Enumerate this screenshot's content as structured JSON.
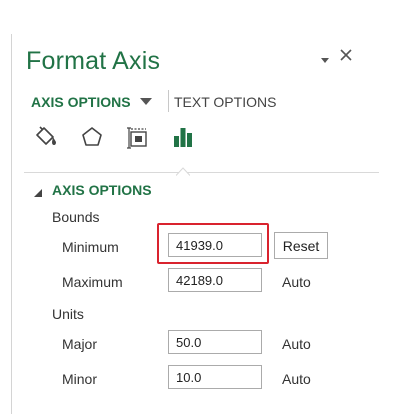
{
  "pane": {
    "title": "Format Axis",
    "accent_color": "#217346",
    "header_icons": [
      "chevron-down-icon",
      "close-icon"
    ]
  },
  "tabs": {
    "axis_options": "AXIS OPTIONS",
    "text_options": "TEXT OPTIONS"
  },
  "category_icons": [
    "fill-line-icon",
    "effects-pentagon-icon",
    "size-properties-icon",
    "axis-options-bar-chart-icon"
  ],
  "section": {
    "title": "AXIS OPTIONS"
  },
  "bounds": {
    "label": "Bounds",
    "minimum": {
      "label": "Minimum",
      "value": "41939.0",
      "action": "Reset"
    },
    "maximum": {
      "label": "Maximum",
      "value": "42189.0",
      "state": "Auto"
    }
  },
  "units": {
    "label": "Units",
    "major": {
      "label": "Major",
      "value": "50.0",
      "state": "Auto"
    },
    "minor": {
      "label": "Minor",
      "value": "10.0",
      "state": "Auto"
    }
  },
  "highlight_color": "#d9232e"
}
